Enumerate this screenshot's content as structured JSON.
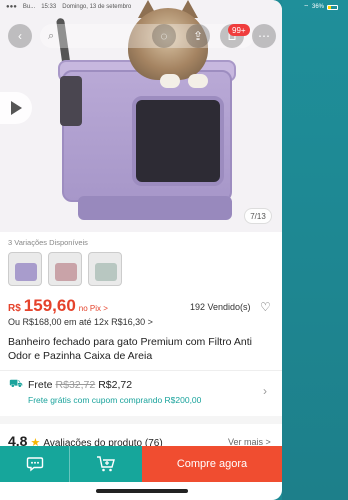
{
  "status_bar": {
    "carrier": "Bu...",
    "time": "15:33",
    "date": "Domingo, 13 de setembro",
    "battery": "36%"
  },
  "header": {
    "cart_badge": "99+",
    "icons": [
      "back-icon",
      "search-icon",
      "chat-icon",
      "share-icon",
      "cart-icon",
      "more-icon"
    ]
  },
  "gallery": {
    "counter": "7/13"
  },
  "variations": {
    "label": "3 Variações Disponíveis",
    "thumb_colors": [
      "#a89ccc",
      "#c9a3a8",
      "#b8c7c1"
    ]
  },
  "price": {
    "currency": "R$",
    "value": "159,60",
    "pix_label": "no Pix >",
    "sold": "192 Vendido(s)",
    "installments": "Ou R$168,00 em até 12x R$16,30 >"
  },
  "product": {
    "title": "Banheiro fechado para gato Premium com Filtro Anti Odor e Pazinha Caixa de Areia"
  },
  "shipping": {
    "label": "Frete",
    "old_price": "R$32,72",
    "new_price": "R$2,72",
    "note": "Frete grátis com cupom comprando R$200,00"
  },
  "reviews": {
    "rating": "4.8",
    "label": "Avaliações do produto (76)",
    "see_more": "Ver mais >"
  },
  "bottom_bar": {
    "buy_label": "Compre agora"
  },
  "colors": {
    "accent": "#16a69b",
    "price_red": "#e5422b",
    "buy_button": "#f04d30"
  }
}
